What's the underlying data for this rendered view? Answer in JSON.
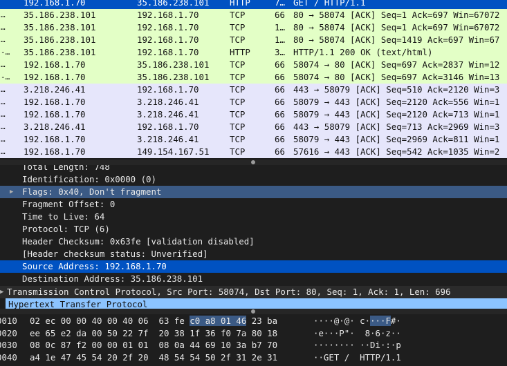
{
  "colors": {
    "http_row": "#e3ffc6",
    "tcp_ack_row": "#e6e6fb",
    "selected_row": "#0052c2",
    "highlight_field": "#3b5a85",
    "http_layer": "#8cc4ff",
    "background": "#1e1e1e"
  },
  "packet_list": {
    "rows": [
      {
        "mark": "",
        "src": "192.168.1.70",
        "dst": "35.186.238.101",
        "proto": "HTTP",
        "len": "7…",
        "info": "GET / HTTP/1.1",
        "style": "sel"
      },
      {
        "mark": "…",
        "src": "35.186.238.101",
        "dst": "192.168.1.70",
        "proto": "TCP",
        "len": "66",
        "info": "80 → 58074 [ACK] Seq=1 Ack=697 Win=67072",
        "style": "green"
      },
      {
        "mark": "…",
        "src": "35.186.238.101",
        "dst": "192.168.1.70",
        "proto": "TCP",
        "len": "1…",
        "info": "80 → 58074 [ACK] Seq=1 Ack=697 Win=67072",
        "style": "green"
      },
      {
        "mark": "…",
        "src": "35.186.238.101",
        "dst": "192.168.1.70",
        "proto": "TCP",
        "len": "1…",
        "info": "80 → 58074 [ACK] Seq=1419 Ack=697 Win=67",
        "style": "green"
      },
      {
        "mark": "-…",
        "src": "35.186.238.101",
        "dst": "192.168.1.70",
        "proto": "HTTP",
        "len": "3…",
        "info": "HTTP/1.1 200 OK  (text/html)",
        "style": "green"
      },
      {
        "mark": "…",
        "src": "192.168.1.70",
        "dst": "35.186.238.101",
        "proto": "TCP",
        "len": "66",
        "info": "58074 → 80 [ACK] Seq=697 Ack=2837 Win=12",
        "style": "green"
      },
      {
        "mark": "-…",
        "src": "192.168.1.70",
        "dst": "35.186.238.101",
        "proto": "TCP",
        "len": "66",
        "info": "58074 → 80 [ACK] Seq=697 Ack=3146 Win=13",
        "style": "green"
      },
      {
        "mark": "…",
        "src": "3.218.246.41",
        "dst": "192.168.1.70",
        "proto": "TCP",
        "len": "66",
        "info": "443 → 58079 [ACK] Seq=510 Ack=2120 Win=3",
        "style": "lav"
      },
      {
        "mark": "…",
        "src": "192.168.1.70",
        "dst": "3.218.246.41",
        "proto": "TCP",
        "len": "66",
        "info": "58079 → 443 [ACK] Seq=2120 Ack=556 Win=1",
        "style": "lav"
      },
      {
        "mark": "…",
        "src": "192.168.1.70",
        "dst": "3.218.246.41",
        "proto": "TCP",
        "len": "66",
        "info": "58079 → 443 [ACK] Seq=2120 Ack=713 Win=1",
        "style": "lav"
      },
      {
        "mark": "…",
        "src": "3.218.246.41",
        "dst": "192.168.1.70",
        "proto": "TCP",
        "len": "66",
        "info": "443 → 58079 [ACK] Seq=713 Ack=2969 Win=3",
        "style": "lav"
      },
      {
        "mark": "…",
        "src": "192.168.1.70",
        "dst": "3.218.246.41",
        "proto": "TCP",
        "len": "66",
        "info": "58079 → 443 [ACK] Seq=2969 Ack=811 Win=1",
        "style": "lav"
      },
      {
        "mark": "…",
        "src": "192.168.1.70",
        "dst": "149.154.167.51",
        "proto": "TCP",
        "len": "66",
        "info": "57616 → 443 [ACK] Seq=542 Ack=1035 Win=2",
        "style": "lav"
      }
    ]
  },
  "details": {
    "rows": [
      {
        "text": "Total Length: 748",
        "style": "",
        "arrow": ""
      },
      {
        "text": "Identification: 0x0000 (0)",
        "style": "",
        "arrow": ""
      },
      {
        "text": "Flags: 0x40, Don't fragment",
        "style": "hl",
        "arrow": "▶"
      },
      {
        "text": "Fragment Offset: 0",
        "style": "",
        "arrow": ""
      },
      {
        "text": "Time to Live: 64",
        "style": "",
        "arrow": ""
      },
      {
        "text": "Protocol: TCP (6)",
        "style": "",
        "arrow": ""
      },
      {
        "text": "Header Checksum: 0x63fe [validation disabled]",
        "style": "",
        "arrow": ""
      },
      {
        "text": "[Header checksum status: Unverified]",
        "style": "",
        "arrow": ""
      },
      {
        "text": "Source Address: 192.168.1.70",
        "style": "sel",
        "arrow": ""
      },
      {
        "text": "Destination Address: 35.186.238.101",
        "style": "",
        "arrow": ""
      },
      {
        "text": "Transmission Control Protocol, Src Port: 58074, Dst Port: 80, Seq: 1, Ack: 1, Len: 696",
        "style": "tcp",
        "arrow": "▶"
      },
      {
        "text": "Hypertext Transfer Protocol",
        "style": "http",
        "arrow": ""
      }
    ]
  },
  "bytes": {
    "rows": [
      {
        "offset": "0010",
        "hex_pre": "02 ec 00 00 40 00 40 06  63 fe ",
        "hex_hl": "c0 a8 01 46",
        "hex_post": " 23 ba",
        "ascii_pre": "····@·@· c·",
        "ascii_hl": "···F",
        "ascii_post": "#·"
      },
      {
        "offset": "0020",
        "hex_pre": "ee 65 e2 da 00 50 22 7f  20 38 1f 36 f0 7a 80 18",
        "hex_hl": "",
        "hex_post": "",
        "ascii_pre": "·e···P\"·  8·6·z··",
        "ascii_hl": "",
        "ascii_post": ""
      },
      {
        "offset": "0030",
        "hex_pre": "08 0c 87 f2 00 00 01 01  08 0a 44 69 10 3a b7 70",
        "hex_hl": "",
        "hex_post": "",
        "ascii_pre": "········ ··Di·:·p",
        "ascii_hl": "",
        "ascii_post": ""
      },
      {
        "offset": "0040",
        "hex_pre": "a4 1e 47 45 54 20 2f 20  48 54 54 50 2f 31 2e 31",
        "hex_hl": "",
        "hex_post": "",
        "ascii_pre": "··GET /  HTTP/1.1",
        "ascii_hl": "",
        "ascii_post": ""
      }
    ]
  }
}
